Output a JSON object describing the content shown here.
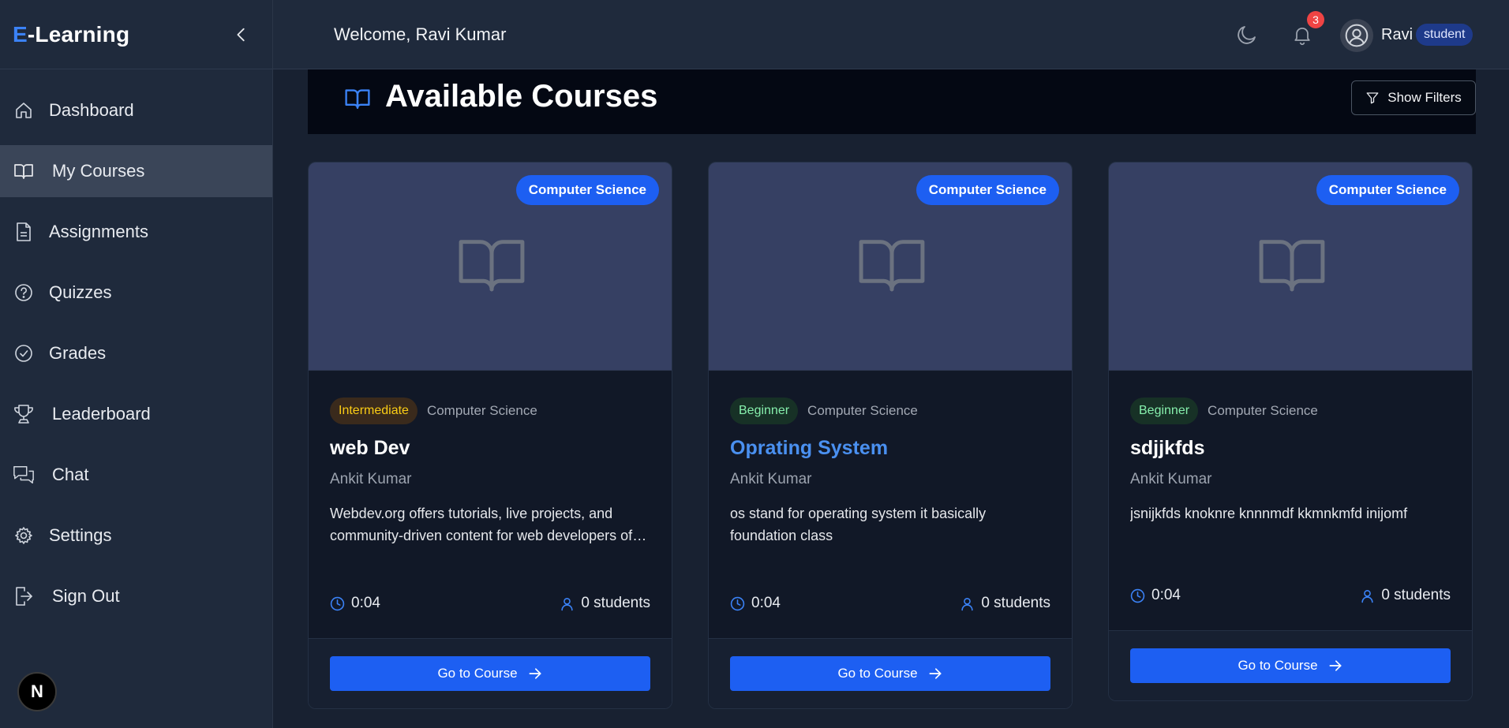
{
  "app": {
    "brand_prefix": "E",
    "brand_rest": "-Learning"
  },
  "sidebar": {
    "items": [
      {
        "label": "Dashboard",
        "icon": "home-icon"
      },
      {
        "label": "My Courses",
        "icon": "book-icon",
        "active": true
      },
      {
        "label": "Assignments",
        "icon": "file-text-icon"
      },
      {
        "label": "Quizzes",
        "icon": "help-circle-icon"
      },
      {
        "label": "Grades",
        "icon": "check-circle-icon"
      },
      {
        "label": "Leaderboard",
        "icon": "trophy-icon"
      },
      {
        "label": "Chat",
        "icon": "chat-icon"
      },
      {
        "label": "Settings",
        "icon": "gear-icon"
      },
      {
        "label": "Sign Out",
        "icon": "sign-out-icon"
      }
    ],
    "bottom_badge": "N"
  },
  "header": {
    "welcome": "Welcome, Ravi Kumar",
    "notification_count": "3",
    "user_name": "Ravi",
    "role": "student"
  },
  "main": {
    "title": "Available Courses",
    "filter_label": "Show Filters"
  },
  "colors": {
    "accent": "#1d5ff2",
    "brand_accent": "#3b82f6",
    "intermediate": "#facc15",
    "beginner": "#86efac"
  },
  "courses": [
    {
      "category_badge": "Computer Science",
      "level": "Intermediate",
      "category": "Computer Science",
      "title": "web Dev",
      "instructor": "Ankit Kumar",
      "description": "Webdev.org offers tutorials, live projects, and community-driven content for web developers of all levels.",
      "duration": "0:04",
      "students": "0 students",
      "button": "Go to Course"
    },
    {
      "category_badge": "Computer Science",
      "level": "Beginner",
      "category": "Computer Science",
      "title": "Oprating System",
      "instructor": "Ankit Kumar",
      "description": "os stand for operating system it basically foundation class",
      "duration": "0:04",
      "students": "0 students",
      "button": "Go to Course"
    },
    {
      "category_badge": "Computer Science",
      "level": "Beginner",
      "category": "Computer Science",
      "title": "sdjjkfds",
      "instructor": "Ankit Kumar",
      "description": "jsnijkfds knoknre knnnmdf kkmnkmfd inijomf",
      "duration": "0:04",
      "students": "0 students",
      "button": "Go to Course"
    }
  ]
}
